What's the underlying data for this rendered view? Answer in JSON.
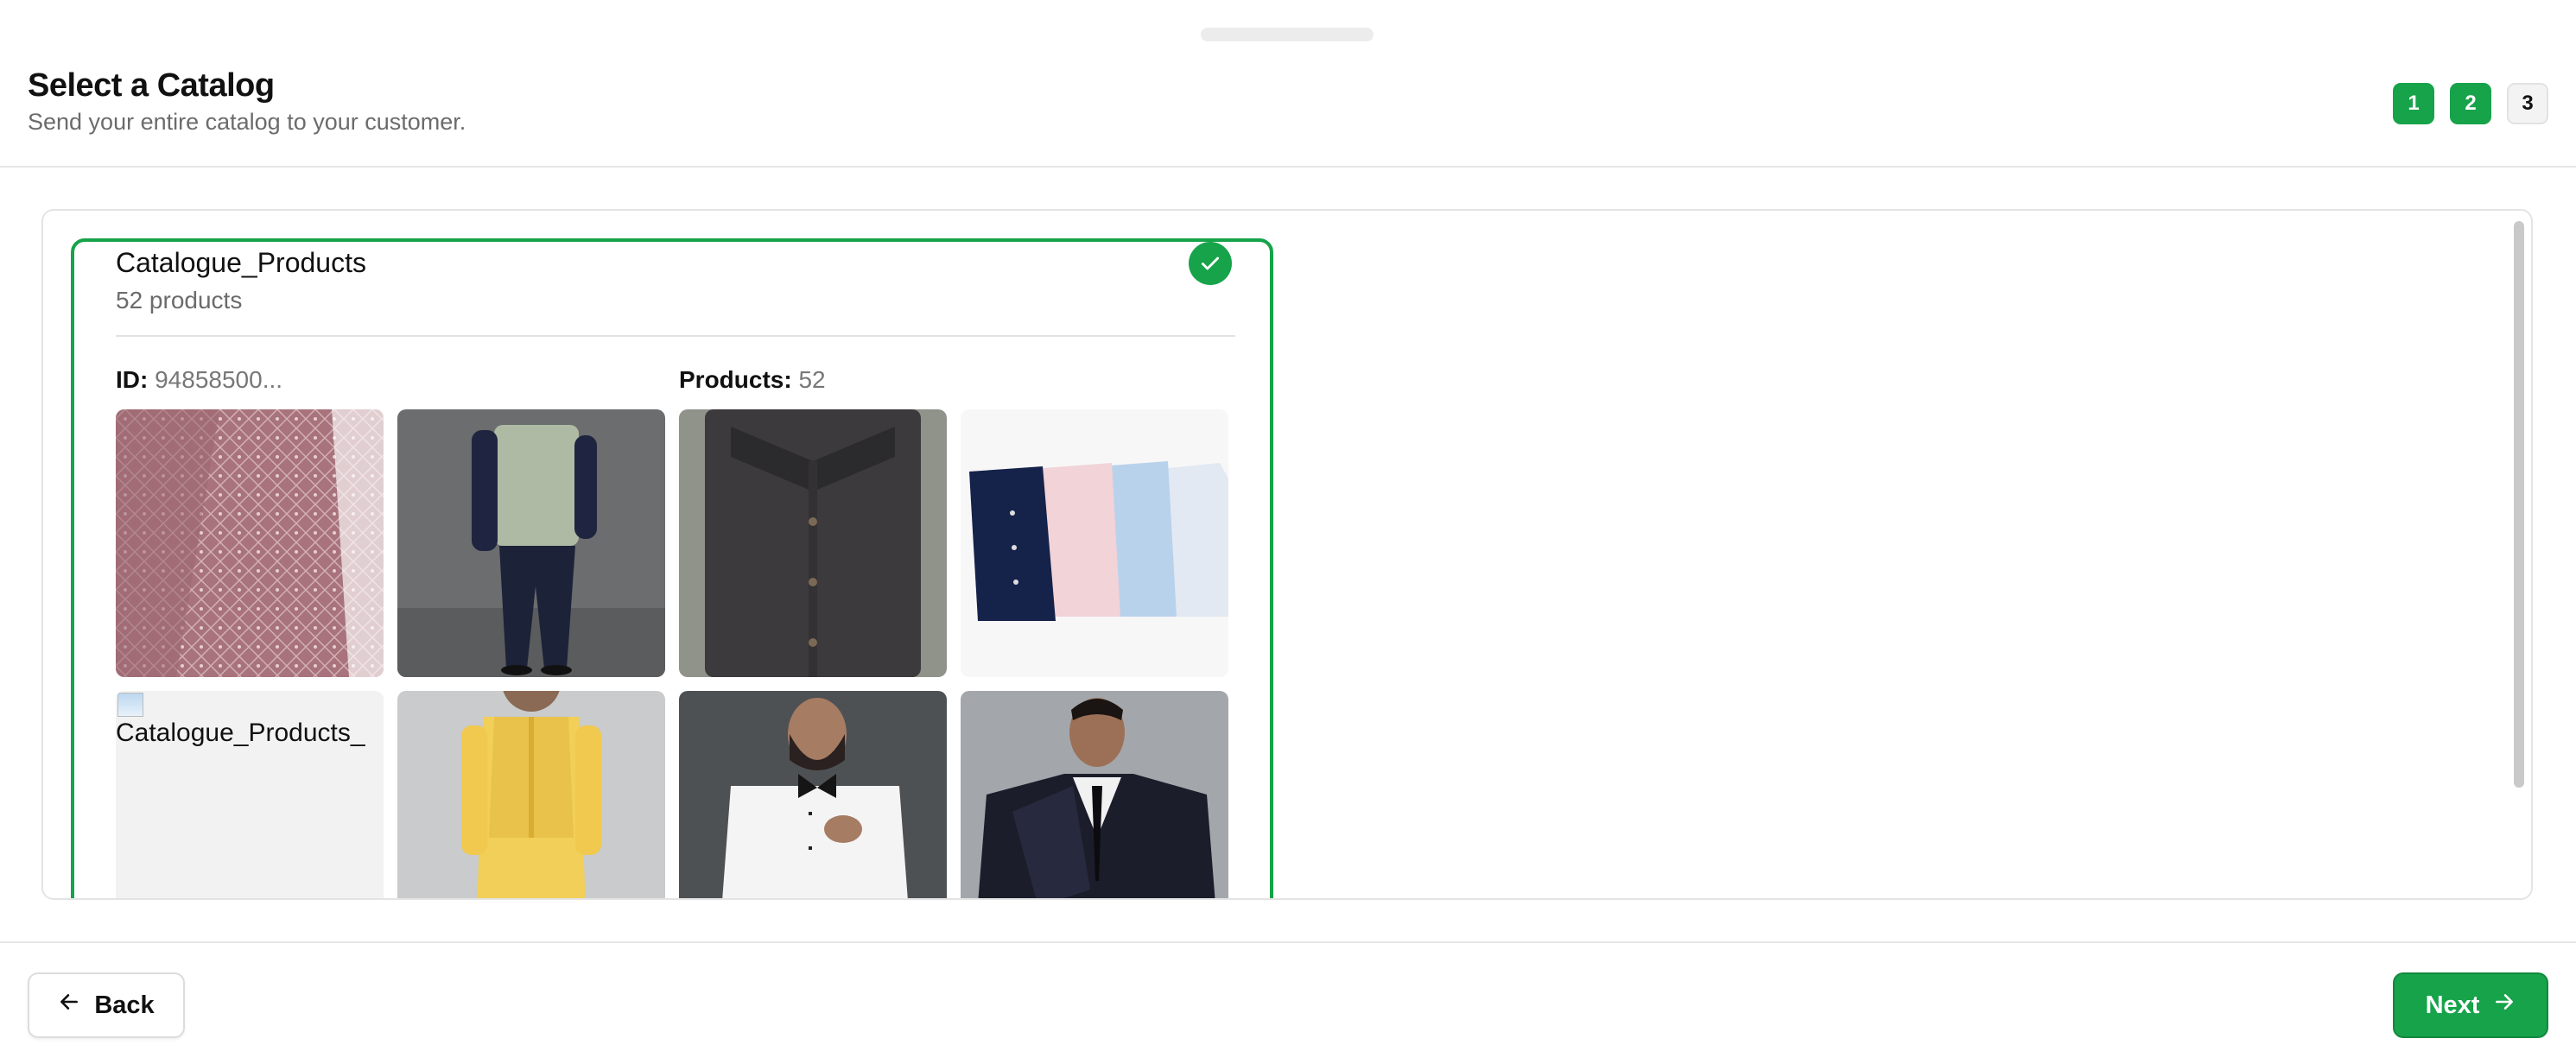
{
  "header": {
    "title": "Select a Catalog",
    "subtitle": "Send your entire catalog to your customer.",
    "steps": [
      {
        "label": "1",
        "state": "active"
      },
      {
        "label": "2",
        "state": "active"
      },
      {
        "label": "3",
        "state": "inactive"
      }
    ]
  },
  "catalog": {
    "name": "Catalogue_Products",
    "count_text": "52 products",
    "selected": true,
    "id_label": "ID:",
    "id_value": "94858500...",
    "products_label": "Products:",
    "products_value": "52",
    "thumbnails": [
      {
        "name": "pink-sequin-kurta-image"
      },
      {
        "name": "sage-nehru-jacket-image"
      },
      {
        "name": "dark-grey-shirt-image"
      },
      {
        "name": "four-shirts-image"
      },
      {
        "name": "broken-image",
        "alt": "Catalogue_Products_"
      },
      {
        "name": "yellow-kurta-jacket-image"
      },
      {
        "name": "white-tuxedo-shirt-image"
      },
      {
        "name": "black-velvet-suit-image"
      }
    ]
  },
  "footer": {
    "back_label": "Back",
    "next_label": "Next"
  },
  "colors": {
    "accent": "#16a34a"
  }
}
